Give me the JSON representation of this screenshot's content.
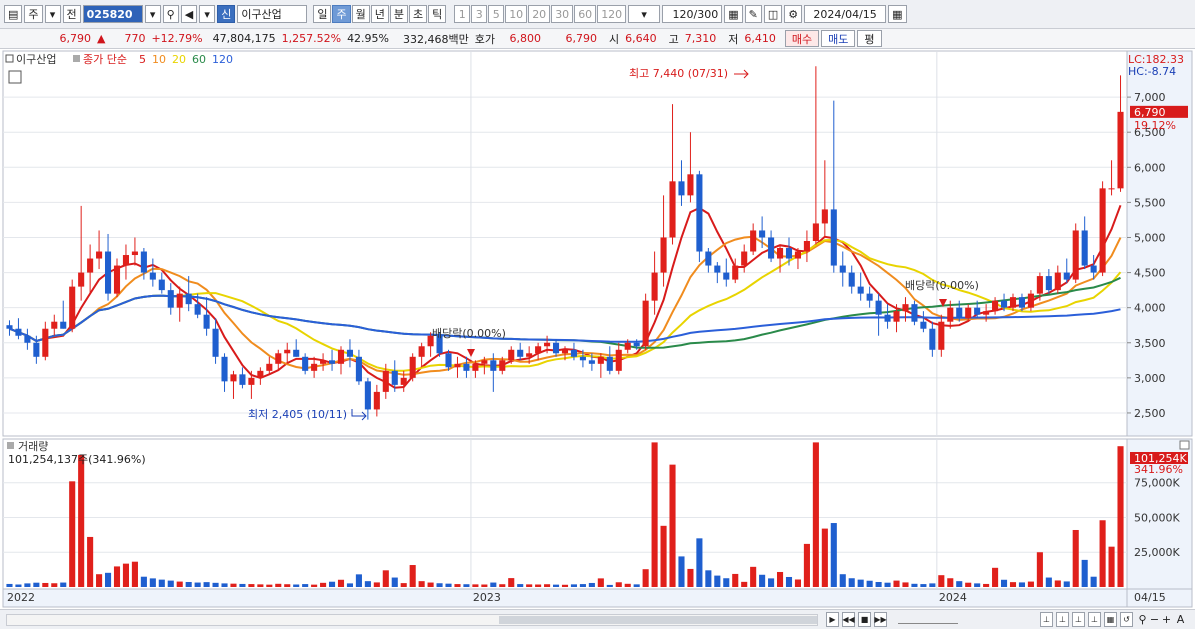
{
  "toolbar": {
    "main_menu": "주",
    "prev_label": "전",
    "code": "025820",
    "badge": "신",
    "stock_name": "이구산업",
    "periods": [
      "일",
      "주",
      "월",
      "년",
      "분",
      "초",
      "틱"
    ],
    "selected_period": "주",
    "intervals": [
      "1",
      "3",
      "5",
      "10",
      "20",
      "30",
      "60",
      "120"
    ],
    "count": "120",
    "count_total": "/300",
    "date": "2024/04/15"
  },
  "quote": {
    "price": "6,790",
    "change": "770",
    "change_pct": "+12.79%",
    "volume": "47,804,175",
    "volume_pct": "1,257.52%",
    "turnover_pct": "42.95%",
    "amount": "332,468백만",
    "ask_label": "호가",
    "ask": "6,800",
    "bid": "6,790",
    "open_label": "시",
    "open": "6,640",
    "high_label": "고",
    "high": "7,310",
    "low_label": "저",
    "low": "6,410",
    "buy_button": "매수",
    "sell_button": "매도",
    "avg_button": "평"
  },
  "price_panel": {
    "name": "이구산업",
    "close_label": "종가 단순",
    "ma_periods": [
      "5",
      "10",
      "20",
      "60",
      "120"
    ],
    "ma_colors": [
      "#d81b1b",
      "#f08c1e",
      "#e8d400",
      "#2a8a4a",
      "#2b5fd9"
    ],
    "lc": "LC:182.33",
    "hc": "HC:-8.74",
    "price_tag": "6,790",
    "pct_tag": "19.12%",
    "max_label": "최고 7,440 (07/31)",
    "min_label": "최저 2,405 (10/11)",
    "dividend_labels": [
      "배당락(0.00%)",
      "배당락(0.00%)"
    ],
    "y_ticks": [
      "7,000",
      "6,500",
      "6,000",
      "5,500",
      "5,000",
      "4,500",
      "4,000",
      "3,500",
      "3,000",
      "2,500"
    ]
  },
  "volume_panel": {
    "title": "거래량",
    "value_text": "101,254,137주(341.96%)",
    "tag_value": "101,254K",
    "tag_pct": "341.96%",
    "y_ticks": [
      "75,000K",
      "50,000K",
      "25,000K"
    ]
  },
  "x_axis": {
    "labels": [
      "2022",
      "2023",
      "2024"
    ],
    "last_date": "04/15"
  },
  "chart_data": {
    "type": "candlestick",
    "timeframe": "weekly",
    "ylim": [
      2200,
      7600
    ],
    "vol_ylim": [
      0,
      105000
    ],
    "up_color": "#e0201b",
    "down_color": "#1f5fcf",
    "candles": [
      [
        3750,
        3820,
        3600,
        3700,
        2200
      ],
      [
        3700,
        3850,
        3550,
        3600,
        1800
      ],
      [
        3600,
        3700,
        3400,
        3500,
        2600
      ],
      [
        3500,
        3600,
        3200,
        3300,
        3100
      ],
      [
        3300,
        3800,
        3250,
        3700,
        2900
      ],
      [
        3700,
        3900,
        3600,
        3800,
        2700
      ],
      [
        3800,
        4100,
        3700,
        3700,
        3200
      ],
      [
        3700,
        4400,
        3650,
        4300,
        76000
      ],
      [
        4300,
        5450,
        4100,
        4500,
        95000
      ],
      [
        4500,
        4900,
        4200,
        4700,
        36000
      ],
      [
        4700,
        5100,
        4550,
        4800,
        9200
      ],
      [
        4800,
        5050,
        4100,
        4200,
        10200
      ],
      [
        4200,
        4700,
        4150,
        4600,
        14800
      ],
      [
        4600,
        4900,
        4400,
        4750,
        16800
      ],
      [
        4750,
        5000,
        4600,
        4800,
        18200
      ],
      [
        4800,
        4850,
        4400,
        4500,
        7400
      ],
      [
        4500,
        4700,
        4300,
        4400,
        6200
      ],
      [
        4400,
        4500,
        4200,
        4250,
        5300
      ],
      [
        4250,
        4350,
        3900,
        4000,
        4600
      ],
      [
        4000,
        4300,
        3800,
        4200,
        3900
      ],
      [
        4200,
        4450,
        3950,
        4050,
        3600
      ],
      [
        4050,
        4200,
        3850,
        3900,
        3200
      ],
      [
        3900,
        4150,
        3600,
        3700,
        3500
      ],
      [
        3700,
        3850,
        3200,
        3300,
        3000
      ],
      [
        3300,
        3350,
        2800,
        2950,
        2600
      ],
      [
        2950,
        3100,
        2700,
        3050,
        2400
      ],
      [
        3050,
        3150,
        2850,
        2900,
        2200
      ],
      [
        2900,
        3100,
        2700,
        3000,
        2100
      ],
      [
        3000,
        3150,
        2900,
        3100,
        1900
      ],
      [
        3100,
        3300,
        3050,
        3200,
        1700
      ],
      [
        3200,
        3400,
        3100,
        3350,
        2300
      ],
      [
        3350,
        3500,
        3200,
        3400,
        2000
      ],
      [
        3400,
        3550,
        3300,
        3300,
        1800
      ],
      [
        3300,
        3350,
        3050,
        3100,
        2100
      ],
      [
        3100,
        3300,
        3000,
        3200,
        1700
      ],
      [
        3200,
        3350,
        3100,
        3250,
        3000
      ],
      [
        3250,
        3400,
        3100,
        3200,
        3800
      ],
      [
        3200,
        3450,
        3050,
        3400,
        5200
      ],
      [
        3400,
        3550,
        3150,
        3300,
        2600
      ],
      [
        3300,
        3400,
        2900,
        2950,
        9100
      ],
      [
        2950,
        3000,
        2405,
        2550,
        4200
      ],
      [
        2550,
        2900,
        2450,
        2800,
        3300
      ],
      [
        2800,
        3200,
        2700,
        3100,
        12000
      ],
      [
        3100,
        3250,
        2800,
        2900,
        6800
      ],
      [
        2900,
        3100,
        2800,
        3000,
        2800
      ],
      [
        3000,
        3350,
        2950,
        3300,
        15800
      ],
      [
        3300,
        3500,
        3150,
        3450,
        4200
      ],
      [
        3450,
        3650,
        3300,
        3600,
        3200
      ],
      [
        3600,
        3650,
        3300,
        3350,
        2700
      ],
      [
        3350,
        3400,
        3100,
        3150,
        2400
      ],
      [
        3150,
        3300,
        3000,
        3200,
        2100
      ],
      [
        3200,
        3300,
        3000,
        3100,
        2000
      ],
      [
        3100,
        3250,
        3000,
        3200,
        1900
      ],
      [
        3200,
        3300,
        3050,
        3250,
        1800
      ],
      [
        3250,
        3350,
        2800,
        3100,
        3200
      ],
      [
        3100,
        3300,
        3050,
        3250,
        2000
      ],
      [
        3250,
        3450,
        3200,
        3400,
        6400
      ],
      [
        3400,
        3500,
        3250,
        3300,
        2100
      ],
      [
        3300,
        3450,
        3200,
        3350,
        1900
      ],
      [
        3350,
        3500,
        3250,
        3450,
        1800
      ],
      [
        3450,
        3600,
        3350,
        3500,
        2000
      ],
      [
        3500,
        3550,
        3300,
        3350,
        1700
      ],
      [
        3350,
        3450,
        3250,
        3400,
        1600
      ],
      [
        3400,
        3500,
        3250,
        3300,
        1900
      ],
      [
        3300,
        3400,
        3150,
        3250,
        2100
      ],
      [
        3250,
        3350,
        3100,
        3200,
        2900
      ],
      [
        3200,
        3350,
        3000,
        3300,
        6200
      ],
      [
        3300,
        3450,
        3050,
        3100,
        1500
      ],
      [
        3100,
        3500,
        3050,
        3400,
        3400
      ],
      [
        3400,
        3550,
        3350,
        3500,
        2300
      ],
      [
        3500,
        3550,
        3400,
        3450,
        1900
      ],
      [
        3450,
        4200,
        3400,
        4100,
        12800
      ],
      [
        4100,
        4800,
        3900,
        4500,
        104000
      ],
      [
        4500,
        5600,
        4300,
        5000,
        44000
      ],
      [
        5000,
        6900,
        4900,
        5800,
        88000
      ],
      [
        5800,
        6100,
        5450,
        5600,
        22000
      ],
      [
        5600,
        6500,
        5500,
        5900,
        13000
      ],
      [
        5900,
        5950,
        4650,
        4800,
        35000
      ],
      [
        4800,
        4850,
        4500,
        4600,
        12000
      ],
      [
        4600,
        4650,
        4350,
        4500,
        8200
      ],
      [
        4500,
        4700,
        4300,
        4400,
        6300
      ],
      [
        4400,
        4700,
        4350,
        4600,
        9400
      ],
      [
        4600,
        4900,
        4500,
        4800,
        3700
      ],
      [
        4800,
        5200,
        4750,
        5100,
        14500
      ],
      [
        5100,
        5300,
        4850,
        5000,
        8800
      ],
      [
        5000,
        5100,
        4650,
        4700,
        6200
      ],
      [
        4700,
        4900,
        4500,
        4850,
        10800
      ],
      [
        4850,
        5000,
        4600,
        4700,
        7200
      ],
      [
        4700,
        4850,
        4550,
        4800,
        5400
      ],
      [
        4800,
        5100,
        4650,
        4950,
        31000
      ],
      [
        4950,
        7440,
        4900,
        5200,
        104000
      ],
      [
        5200,
        6100,
        5000,
        5400,
        42000
      ],
      [
        5400,
        6950,
        4500,
        4600,
        46000
      ],
      [
        4600,
        4800,
        4300,
        4500,
        9200
      ],
      [
        4500,
        4600,
        4200,
        4300,
        6300
      ],
      [
        4300,
        4500,
        4100,
        4200,
        5300
      ],
      [
        4200,
        4300,
        4000,
        4100,
        4500
      ],
      [
        4100,
        4200,
        3600,
        3900,
        3600
      ],
      [
        3900,
        4050,
        3700,
        3800,
        3100
      ],
      [
        3800,
        4050,
        3650,
        3950,
        4600
      ],
      [
        3950,
        4150,
        3800,
        4050,
        3300
      ],
      [
        4050,
        4100,
        3750,
        3800,
        2300
      ],
      [
        3800,
        3950,
        3650,
        3700,
        2100
      ],
      [
        3700,
        3800,
        3300,
        3400,
        2600
      ],
      [
        3400,
        3900,
        3300,
        3800,
        8500
      ],
      [
        3800,
        4100,
        3700,
        4000,
        6300
      ],
      [
        4000,
        4100,
        3800,
        3850,
        4200
      ],
      [
        3850,
        4050,
        3800,
        4000,
        3100
      ],
      [
        4000,
        4100,
        3850,
        3900,
        2600
      ],
      [
        3900,
        4050,
        3800,
        3950,
        2200
      ],
      [
        3950,
        4150,
        3900,
        4100,
        13800
      ],
      [
        4100,
        4200,
        3950,
        4000,
        5200
      ],
      [
        4000,
        4200,
        3950,
        4150,
        3500
      ],
      [
        4150,
        4200,
        3950,
        4000,
        3300
      ],
      [
        4000,
        4250,
        3950,
        4200,
        3900
      ],
      [
        4200,
        4500,
        4100,
        4450,
        25000
      ],
      [
        4450,
        4550,
        4200,
        4250,
        6800
      ],
      [
        4250,
        4600,
        4200,
        4500,
        4700
      ],
      [
        4500,
        4700,
        4350,
        4400,
        4000
      ],
      [
        4400,
        5200,
        4350,
        5100,
        41000
      ],
      [
        5100,
        5300,
        4550,
        4600,
        19500
      ],
      [
        4600,
        4750,
        4400,
        4500,
        7400
      ],
      [
        4500,
        5800,
        4450,
        5700,
        48000
      ],
      [
        5700,
        6100,
        5600,
        5700,
        29000
      ],
      [
        5700,
        7310,
        5650,
        6790,
        101254
      ]
    ]
  }
}
